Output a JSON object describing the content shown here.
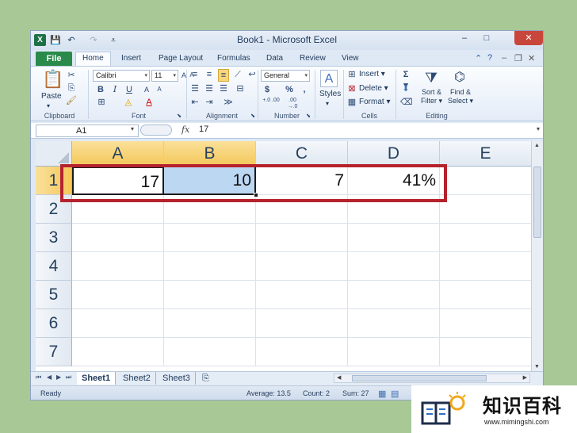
{
  "window": {
    "title": "Book1 - Microsoft Excel",
    "controls": {
      "minimize": "–",
      "maximize": "□",
      "close": "✕"
    }
  },
  "quick_access": {
    "logo": "X",
    "save": "💾",
    "undo": "↶",
    "redo": "↷",
    "customize": "⩡"
  },
  "tabs": [
    "File",
    "Home",
    "Insert",
    "Page Layout",
    "Formulas",
    "Data",
    "Review",
    "View"
  ],
  "ribbon": {
    "clipboard": {
      "label": "Clipboard",
      "paste": "Paste"
    },
    "font": {
      "label": "Font",
      "name": "Calibri",
      "size": "11",
      "bold": "B",
      "italic": "I",
      "underline": "U"
    },
    "alignment": {
      "label": "Alignment"
    },
    "number": {
      "label": "Number",
      "format": "General",
      "currency": "$",
      "percent": "%",
      "comma": ",",
      "inc_decimal": "+.0 .00",
      "dec_decimal": ".00 →.0"
    },
    "styles": {
      "label": "Styles"
    },
    "cells": {
      "label": "Cells",
      "insert": "Insert",
      "delete": "Delete",
      "format": "Format"
    },
    "editing": {
      "label": "Editing",
      "sort": "Sort &",
      "filter": "Filter",
      "find": "Find &",
      "select": "Select"
    }
  },
  "formula_bar": {
    "name_box": "A1",
    "fx": "fx",
    "content": "17"
  },
  "grid": {
    "columns": [
      "A",
      "B",
      "C",
      "D",
      "E"
    ],
    "rows": [
      "1",
      "2",
      "3",
      "4",
      "5",
      "6",
      "7"
    ],
    "row1": [
      "17",
      "10",
      "7",
      "41%",
      ""
    ]
  },
  "sheets": [
    "Sheet1",
    "Sheet2",
    "Sheet3"
  ],
  "status": {
    "ready": "Ready",
    "average": "Average: 13.5",
    "count": "Count: 2",
    "sum": "Sum: 27"
  },
  "watermark": {
    "text": "知识百科",
    "url": "www.mimingshi.com"
  }
}
